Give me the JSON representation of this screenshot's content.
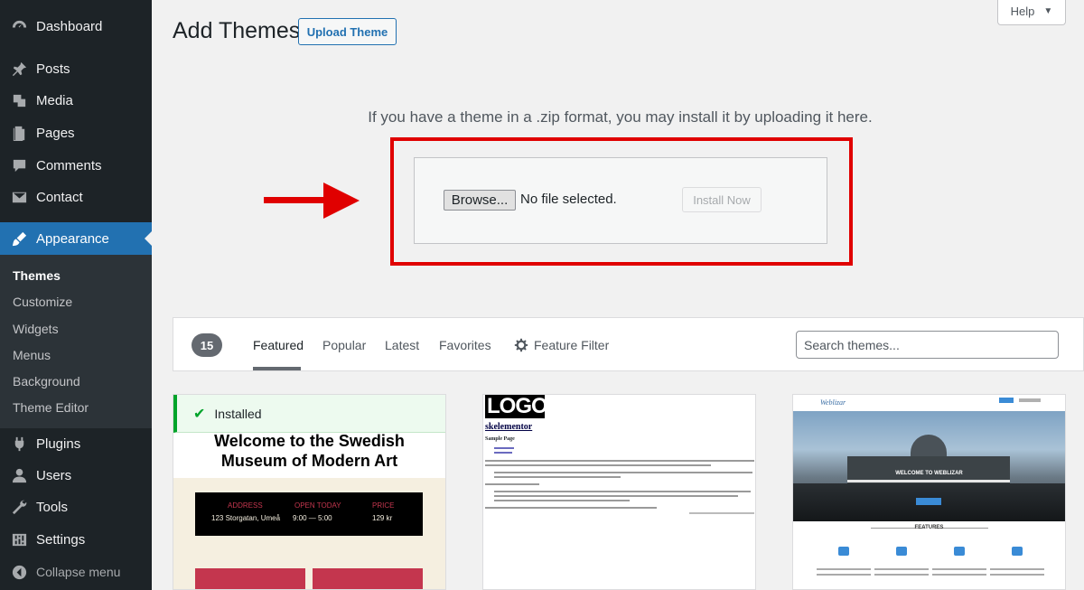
{
  "sidebar": {
    "items": [
      {
        "label": "Dashboard",
        "icon": "dashboard-icon"
      },
      {
        "label": "Posts",
        "icon": "pin-icon"
      },
      {
        "label": "Media",
        "icon": "media-icon"
      },
      {
        "label": "Pages",
        "icon": "pages-icon"
      },
      {
        "label": "Comments",
        "icon": "comment-icon"
      },
      {
        "label": "Contact",
        "icon": "envelope-icon"
      },
      {
        "label": "Appearance",
        "icon": "brush-icon",
        "active": true
      },
      {
        "label": "Plugins",
        "icon": "plug-icon"
      },
      {
        "label": "Users",
        "icon": "user-icon"
      },
      {
        "label": "Tools",
        "icon": "wrench-icon"
      },
      {
        "label": "Settings",
        "icon": "sliders-icon"
      }
    ],
    "submenu": [
      "Themes",
      "Customize",
      "Widgets",
      "Menus",
      "Background",
      "Theme Editor"
    ],
    "collapse_label": "Collapse menu"
  },
  "header": {
    "title": "Add Themes",
    "upload_button": "Upload Theme",
    "help_label": "Help"
  },
  "upload": {
    "help_text": "If you have a theme in a .zip format, you may install it by uploading it here.",
    "browse_label": "Browse...",
    "file_status": "No file selected.",
    "install_label": "Install Now"
  },
  "filter": {
    "count": "15",
    "tabs": [
      "Featured",
      "Popular",
      "Latest",
      "Favorites"
    ],
    "feature_filter": "Feature Filter",
    "search_placeholder": "Search themes..."
  },
  "themes": {
    "card1": {
      "installed_label": "Installed",
      "heading_line1": "Welcome to the Swedish",
      "heading_line2": "Museum of Modern Art",
      "address_label": "ADDRESS",
      "address": "123 Storgatan, Umeå",
      "hours_label": "OPEN TODAY",
      "hours": "9:00 — 5:00",
      "price_label": "PRICE",
      "price": "129 kr"
    },
    "card2": {
      "logo": "LOGO",
      "site_name": "skelementor",
      "page_title": "Sample Page"
    },
    "card3": {
      "logo": "Weblizar",
      "hero_title": "WELCOME TO WEBLIZAR",
      "features_title": "FEATURES"
    }
  },
  "colors": {
    "sidebar_bg": "#1d2327",
    "accent": "#2271b1",
    "highlight": "#e00000",
    "installed": "#00a32a"
  }
}
